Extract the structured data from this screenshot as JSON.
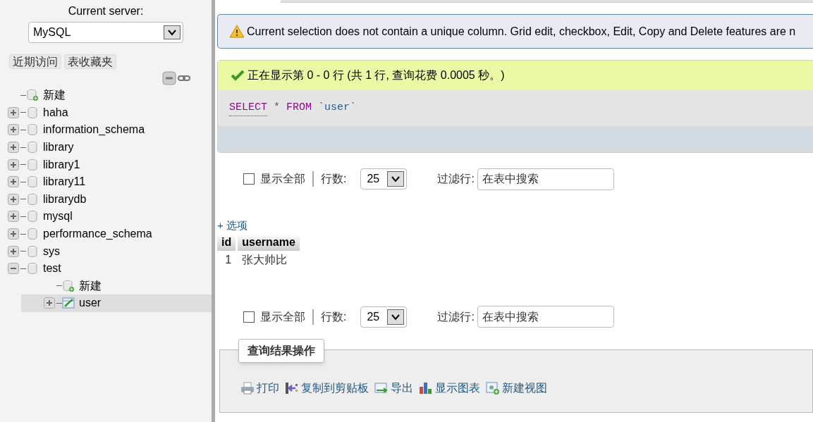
{
  "sidebar": {
    "server_label": "Current server:",
    "server_select": {
      "value": "MySQL"
    },
    "buttons": [
      "近期访问",
      "表收藏夹"
    ],
    "tree": [
      {
        "label": "新建",
        "kind": "new",
        "selected": false
      },
      {
        "label": "haha",
        "kind": "database",
        "expanded": false,
        "selected": false
      },
      {
        "label": "information_schema",
        "kind": "database",
        "expanded": false,
        "selected": false
      },
      {
        "label": "library",
        "kind": "database",
        "expanded": false,
        "selected": false
      },
      {
        "label": "library1",
        "kind": "database",
        "expanded": false,
        "selected": false
      },
      {
        "label": "library11",
        "kind": "database",
        "expanded": false,
        "selected": false
      },
      {
        "label": "librarydb",
        "kind": "database",
        "expanded": false,
        "selected": false
      },
      {
        "label": "mysql",
        "kind": "database",
        "expanded": false,
        "selected": false
      },
      {
        "label": "performance_schema",
        "kind": "database",
        "expanded": false,
        "selected": false
      },
      {
        "label": "sys",
        "kind": "database",
        "expanded": false,
        "selected": false
      },
      {
        "label": "test",
        "kind": "database",
        "expanded": true,
        "selected": false,
        "children": [
          {
            "label": "新建",
            "kind": "new",
            "selected": false
          },
          {
            "label": "user",
            "kind": "table",
            "expanded": false,
            "selected": true
          }
        ]
      }
    ]
  },
  "warning": "Current selection does not contain a unique column. Grid edit, checkbox, Edit, Copy and Delete features are n",
  "success": "正在显示第 0 - 0 行 (共 1 行, 查询花费 0.0005 秒。)",
  "sql": [
    {
      "text": "SELECT",
      "kind": "keyword"
    },
    {
      "text": "*",
      "kind": "plain"
    },
    {
      "text": "FROM",
      "kind": "keyword"
    },
    {
      "text": "`user`",
      "kind": "identifier"
    }
  ],
  "navs": [
    {
      "show_all": {
        "label": "显示全部",
        "checked": false
      },
      "rows_label": "行数:",
      "rows_value": "25",
      "filter_label": "过滤行:",
      "filter_placeholder": "在表中搜索"
    },
    {
      "show_all": {
        "label": "显示全部",
        "checked": false
      },
      "rows_label": "行数:",
      "rows_value": "25",
      "filter_label": "过滤行:",
      "filter_placeholder": "在表中搜索"
    }
  ],
  "options_link": "+ 选项",
  "table": {
    "columns": [
      "id",
      "username"
    ],
    "rows": [
      [
        "1",
        "张大帅比"
      ]
    ]
  },
  "operations": {
    "legend": "查询结果操作",
    "actions": [
      {
        "label": "打印",
        "kind": "print"
      },
      {
        "label": "复制到剪贴板",
        "kind": "copy"
      },
      {
        "label": "导出",
        "kind": "export"
      },
      {
        "label": "显示图表",
        "kind": "chart"
      },
      {
        "label": "新建视图",
        "kind": "view"
      }
    ]
  }
}
